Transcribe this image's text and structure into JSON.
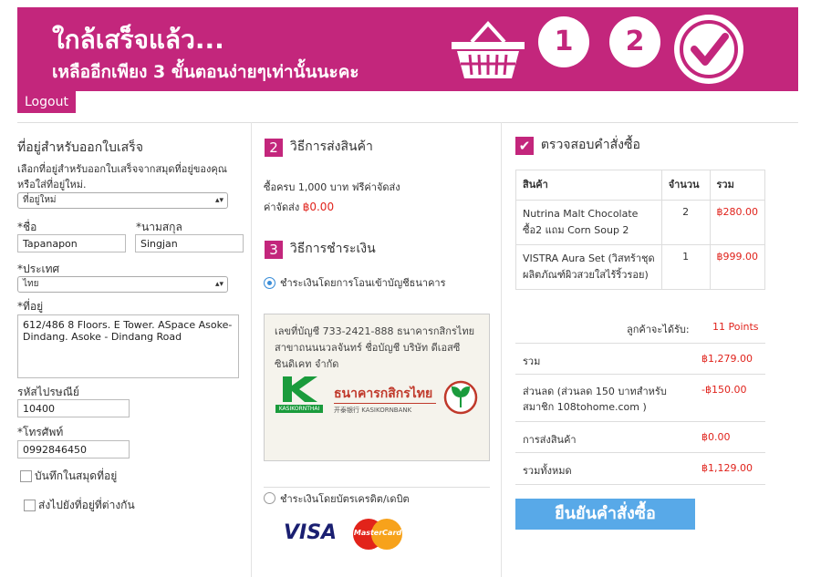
{
  "banner": {
    "title": "ใกล้เสร็จแล้ว...",
    "subtitle": "เหลืออีกเพียง 3 ขั้นตอนง่ายๆเท่านั้นนะคะ",
    "step1": "1",
    "step2": "2"
  },
  "logout_label": "Logout",
  "billing": {
    "heading": "ที่อยู่สำหรับออกใบเสร็จ",
    "hint_line1": "เลือกที่อยู่สำหรับออกใบเสร็จจากสมุดที่อยู่ของคุณ",
    "hint_line2": "หรือใส่ที่อยู่ใหม่.",
    "address_select": "ที่อยู่ใหม่",
    "firstname_label": "*ชื่อ",
    "firstname_value": "Tapanapon",
    "lastname_label": "*นามสกุล",
    "lastname_value": "Singjan",
    "country_label": "*ประเทศ",
    "country_value": "ไทย",
    "address_label": "*ที่อยู่",
    "address_value": "612/486 8 Floors. E Tower. ASpace Asoke-Dindang.  Asoke - Dindang Road",
    "postcode_label": "รหัสไปรษณีย์",
    "postcode_value": "10400",
    "phone_label": "*โทรศัพท์",
    "phone_value": "0992846450",
    "save_label": "บันทึกในสมุดที่อยู่",
    "ship_other_label": "ส่งไปยังที่อยู่ที่ต่างกัน"
  },
  "shipping": {
    "num": "2",
    "heading": "วิธีการส่งสินค้า",
    "note": "ซื้อครบ 1,000 บาท ฟรีค่าจัดส่ง",
    "fee_label": "ค่าจัดส่ง",
    "fee_value": "฿0.00"
  },
  "payment": {
    "num": "3",
    "heading": "วิธีการชำระเงิน",
    "opt_transfer": "ชำระเงินโดยการโอนเข้าบัญชีธนาคาร",
    "bank_line1": "เลขที่บัญชี 733-2421-888 ธนาคารกสิกรไทย",
    "bank_line2": "สาขาถนนนวลจันทร์ ชื่อบัญชี บริษัท ดีเอสซี",
    "bank_line3": "ซินดิเคท จำกัด",
    "bank_logo_text": "KASIKORNTHAI",
    "bank_name_th": "ธนาคารกสิกรไทย",
    "bank_name_en": "开泰银行 KASIKORNBANK",
    "opt_card": "ชำระเงินโดยบัตรเครดิต/เดบิต",
    "visa": "VISA",
    "mastercard": "MasterCard"
  },
  "review": {
    "heading": "ตรวจสอบคำสั่งซื้อ",
    "col_product": "สินค้า",
    "col_qty": "จำนวน",
    "col_total": "รวม",
    "items": [
      {
        "name": "Nutrina Malt Chocolate ซื้อ2 แถม Corn Soup 2",
        "qty": "2",
        "price": "฿280.00"
      },
      {
        "name": "VISTRA Aura Set (วิสทร้าชุดผลิตภัณฑ์ผิวสวยใสไร้ริ้วรอย)",
        "qty": "1",
        "price": "฿999.00"
      }
    ],
    "points_label": "ลูกค้าจะได้รับ:",
    "points_value": "11 Points",
    "subtotal_label": "รวม",
    "subtotal_value": "฿1,279.00",
    "discount_label": "ส่วนลด (ส่วนลด 150 บาทสำหรับสมาชิก 108tohome.com )",
    "discount_value": "-฿150.00",
    "shipping_label": "การส่งสินค้า",
    "shipping_value": "฿0.00",
    "grand_label": "รวมทั้งหมด",
    "grand_value": "฿1,129.00",
    "confirm_label": "ยืนยันคำสั่งซื้อ"
  }
}
